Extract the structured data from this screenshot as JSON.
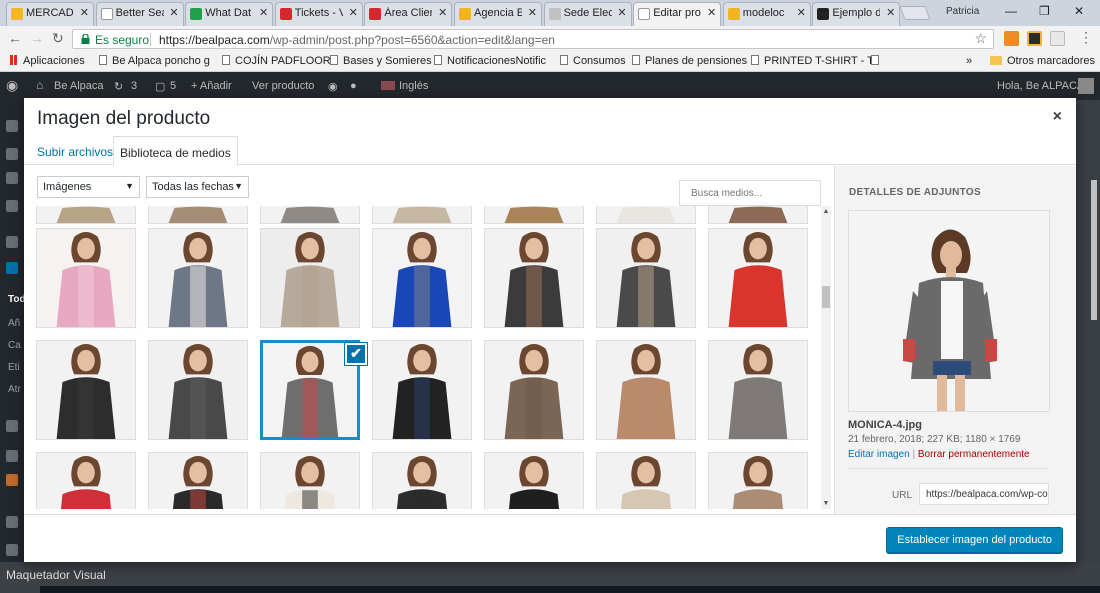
{
  "browser": {
    "tabs": [
      {
        "label": "MERCADO",
        "color": "#f3b71f"
      },
      {
        "label": "Better Sea",
        "color": "#ffffff"
      },
      {
        "label": "What Dat",
        "color": "#21a24a"
      },
      {
        "label": "Tickets - V",
        "color": "#d8262f"
      },
      {
        "label": "Área Clien",
        "color": "#d8262f"
      },
      {
        "label": "Agencia E",
        "color": "#f1b41b"
      },
      {
        "label": "Sede Elec",
        "color": "#c0c0c0"
      },
      {
        "label": "Editar pro",
        "color": "#ffffff"
      },
      {
        "label": "modeloc",
        "color": "#f1b41b"
      },
      {
        "label": "Ejemplo d",
        "color": "#222222"
      }
    ],
    "active_tab": 7,
    "profile_name": "Patricia",
    "window_controls": [
      "—",
      "❐",
      "✕"
    ],
    "secure_label": "Es seguro",
    "url_host": "https://bealpaca.com",
    "url_path": "/wp-admin/post.php?post=6560&action=edit&lang=en",
    "bookmarks": [
      {
        "label": "Aplicaciones",
        "kind": "apps"
      },
      {
        "label": "Be Alpaca poncho g",
        "kind": "page"
      },
      {
        "label": "COJÍN PADFLOOR",
        "kind": "page"
      },
      {
        "label": "Bases y Somieres",
        "kind": "page"
      },
      {
        "label": "NotificacionesNotific",
        "kind": "page"
      },
      {
        "label": "Consumos",
        "kind": "page"
      },
      {
        "label": "Planes de pensiones",
        "kind": "page"
      },
      {
        "label": "PRINTED T-SHIRT - T",
        "kind": "page"
      },
      {
        "label": "",
        "kind": "page"
      }
    ],
    "more_bookmarks": "»",
    "other_bookmarks": "Otros marcadores"
  },
  "adminbar": {
    "site": "Be Alpaca",
    "updates": "3",
    "comments": "5",
    "new_label": "+ Añadir",
    "view_product": "Ver producto",
    "language": "Inglés",
    "greeting": "Hola, Be ALPACA"
  },
  "sidebar_text": [
    "Tod",
    "Añ",
    "Ca",
    "Eti",
    "Atr"
  ],
  "bottom_bar": "Maquetador Visual",
  "modal": {
    "title": "Imagen del producto",
    "close": "×",
    "tabs": [
      "Subir archivos",
      "Biblioteca de medios"
    ],
    "active_tab": 1,
    "filter_type": "Imágenes",
    "filter_date": "Todas las fechas",
    "search_placeholder": "Busca medios...",
    "selected_check": "✔",
    "details": {
      "heading": "DETALLES DE ADJUNTOS",
      "filename": "MONICA-4.jpg",
      "meta": "21 febrero, 2018; 227 KB; 1180 × 1769",
      "edit_link": "Editar imagen",
      "separator": "|",
      "delete_link": "Borrar permanentemente",
      "url_label": "URL",
      "url_value": "https://bealpaca.com/wp-co"
    },
    "submit": "Establecer imagen del producto"
  },
  "thumbs": [
    {
      "top": "#b7a487",
      "bottom": "#b7a487",
      "bg": "#f2f2f2"
    },
    {
      "top": "#a58c74",
      "bottom": "#a58c74",
      "bg": "#f2f2f2"
    },
    {
      "top": "#8f8a86",
      "bottom": "#8f8a86",
      "bg": "#f2f2f2"
    },
    {
      "top": "#c6b7a2",
      "bottom": "#c6b7a2",
      "bg": "#f2f2f2"
    },
    {
      "top": "#a9845a",
      "bottom": "#a9845a",
      "bg": "#f2f2f2"
    },
    {
      "top": "#e9e6e2",
      "bottom": "#e9e6e2",
      "bg": "#f2f2f2"
    },
    {
      "top": "#8c6a55",
      "bottom": "#8c6a55",
      "bg": "#f2f2f2"
    },
    {
      "top": "#e8a8c2",
      "bottom": "#f3c9d8",
      "bg": "#f5f2f1"
    },
    {
      "top": "#6d7788",
      "bottom": "#efe9e3",
      "bg": "#f2f2f2"
    },
    {
      "top": "#b8aa9b",
      "bottom": "#b09f8e",
      "bg": "#ededed"
    },
    {
      "top": "#1a47b8",
      "bottom": "#7b7f86",
      "bg": "#f3f3f3"
    },
    {
      "top": "#3b3b3b",
      "bottom": "#9a6f58",
      "bg": "#f2f2f2"
    },
    {
      "top": "#4a4a4a",
      "bottom": "#b4a086",
      "bg": "#f0f0f0"
    },
    {
      "top": "#d9352d",
      "bottom": "#d9352d",
      "bg": "#f2f2f2"
    },
    {
      "top": "#2d2d2d",
      "bottom": "#3a3a3a",
      "bg": "#f2f2f2"
    },
    {
      "top": "#494949",
      "bottom": "#5b5b5b",
      "bg": "#f0f0f0"
    },
    {
      "top": "#6e6e6e",
      "bottom": "#c8484a",
      "bg": "#f3f3f3"
    },
    {
      "top": "#222222",
      "bottom": "#2c3e6a",
      "bg": "#f2f2f2"
    },
    {
      "top": "#7b6656",
      "bottom": "#6f5a4b",
      "bg": "#f2f2f2"
    },
    {
      "top": "#b98b6b",
      "bottom": "#b98b6b",
      "bg": "#f2f2f2"
    },
    {
      "top": "#7f7a78",
      "bottom": "#7f7a78",
      "bg": "#f2f2f2"
    },
    {
      "top": "#d02f38",
      "bottom": "#d02f38",
      "bg": "#f2f2f2"
    },
    {
      "top": "#2a2a2a",
      "bottom": "#c2473d",
      "bg": "#f2f2f2"
    },
    {
      "top": "#efe8e0",
      "bottom": "#3a3a3a",
      "bg": "#f2f2f2"
    },
    {
      "top": "#2c2c2c",
      "bottom": "#2c2c2c",
      "bg": "#f2f2f2"
    },
    {
      "top": "#1f1f1f",
      "bottom": "#1f1f1f",
      "bg": "#f2f2f2"
    },
    {
      "top": "#d7c6b2",
      "bottom": "#d7c6b2",
      "bg": "#f2f2f2"
    },
    {
      "top": "#ab8c74",
      "bottom": "#ab8c74",
      "bg": "#f2f2f2"
    }
  ],
  "selected_thumb": 16,
  "colors": {
    "accent": "#0073aa",
    "button": "#0085ba",
    "delete": "#aa0000",
    "admin_bar": "#23282d"
  }
}
